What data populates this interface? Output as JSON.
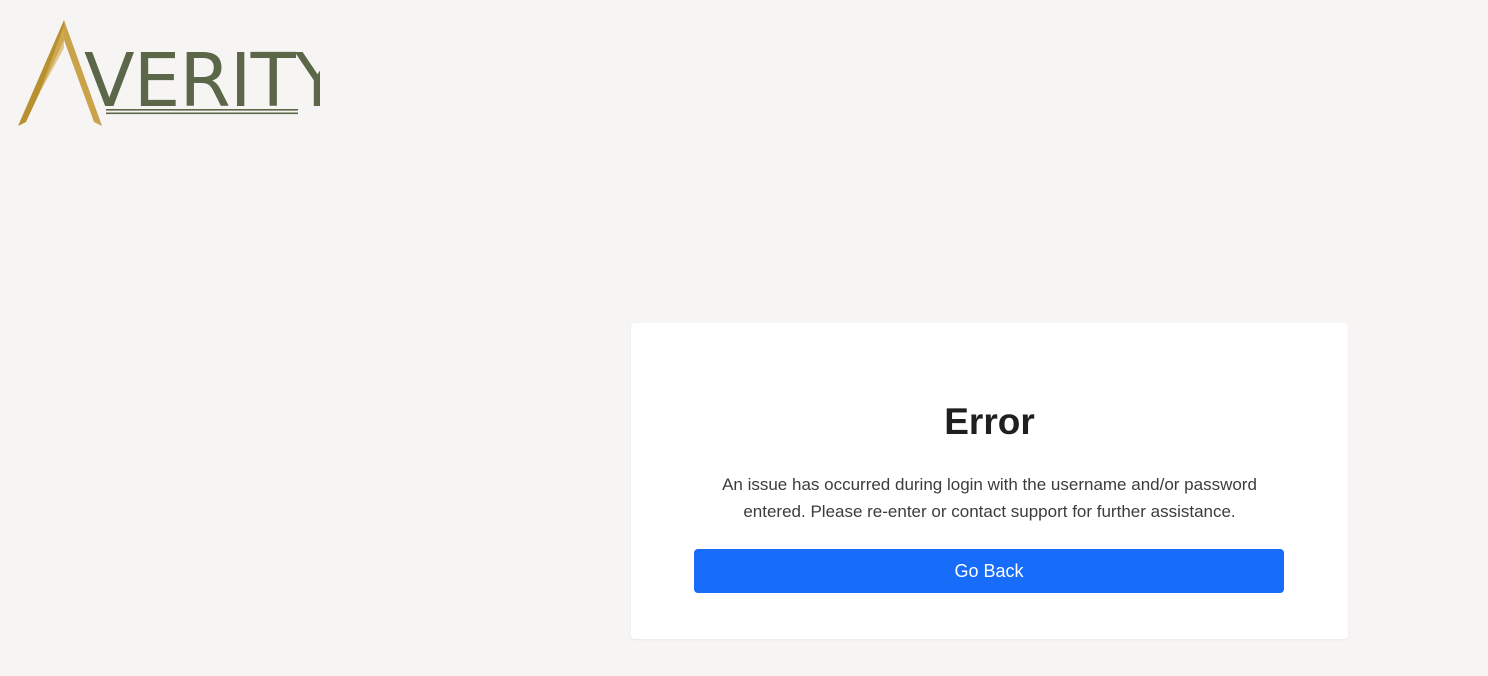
{
  "logo": {
    "text": "VERITY",
    "colors": {
      "gold": "#b8902f",
      "olive": "#5b6748"
    }
  },
  "error_card": {
    "title": "Error",
    "message": "An issue has occurred during login with the username and/or password entered. Please re-enter or contact support for further assistance.",
    "button_label": "Go Back"
  },
  "colors": {
    "page_background": "#f6f5f4",
    "card_background": "#ffffff",
    "button_background": "#176df9",
    "title_text": "#1f1f1f",
    "message_text": "#3c3c3c"
  }
}
